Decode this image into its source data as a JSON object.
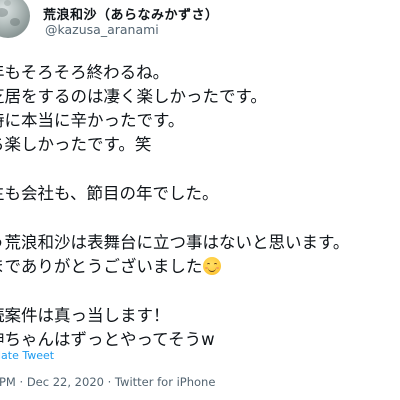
{
  "user": {
    "display_name": "荒浪和沙（あらなみかずさ）",
    "handle": "@kazusa_aranami"
  },
  "tweet": {
    "lines": [
      "年もそろそろ終わるね。",
      "芝居をするのは凄く楽しかったです。",
      "時に本当に辛かったです。",
      "ち楽しかったです。笑",
      "",
      "生も会社も、節目の年でした。",
      "",
      "う荒浪和沙は表舞台に立つ事はないと思います。",
      "までありがとうございました",
      "",
      "続案件は真っ当します！",
      "紳ちゃんはずっとやってそうw"
    ],
    "emoji": "smiling-face-with-smiling-eyes"
  },
  "translate_label": "late Tweet",
  "meta": {
    "time": "PM",
    "date": "Dec 22, 2020",
    "separator": "·",
    "source": "Twitter for iPhone"
  }
}
